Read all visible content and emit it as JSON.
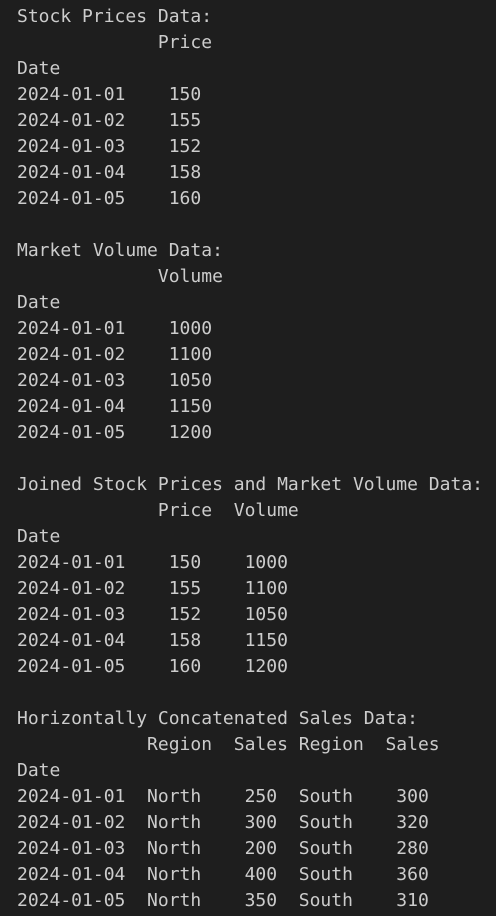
{
  "terminal": {
    "stock_section": {
      "title": "Stock Prices Data:",
      "header": "             Price",
      "index_name": "Date",
      "rows": [
        "2024-01-01    150",
        "2024-01-02    155",
        "2024-01-03    152",
        "2024-01-04    158",
        "2024-01-05    160"
      ]
    },
    "volume_section": {
      "title": "Market Volume Data:",
      "header": "             Volume",
      "index_name": "Date",
      "rows": [
        "2024-01-01    1000",
        "2024-01-02    1100",
        "2024-01-03    1050",
        "2024-01-04    1150",
        "2024-01-05    1200"
      ]
    },
    "joined_section": {
      "title": "Joined Stock Prices and Market Volume Data:",
      "header": "             Price  Volume",
      "index_name": "Date",
      "rows": [
        "2024-01-01    150    1000",
        "2024-01-02    155    1100",
        "2024-01-03    152    1050",
        "2024-01-04    158    1150",
        "2024-01-05    160    1200"
      ]
    },
    "concat_section": {
      "title": "Horizontally Concatenated Sales Data:",
      "header": "            Region  Sales Region  Sales",
      "index_name": "Date",
      "rows": [
        "2024-01-01  North    250  South    300",
        "2024-01-02  North    300  South    320",
        "2024-01-03  North    200  South    280",
        "2024-01-04  North    400  South    360",
        "2024-01-05  North    350  South    310"
      ]
    }
  }
}
